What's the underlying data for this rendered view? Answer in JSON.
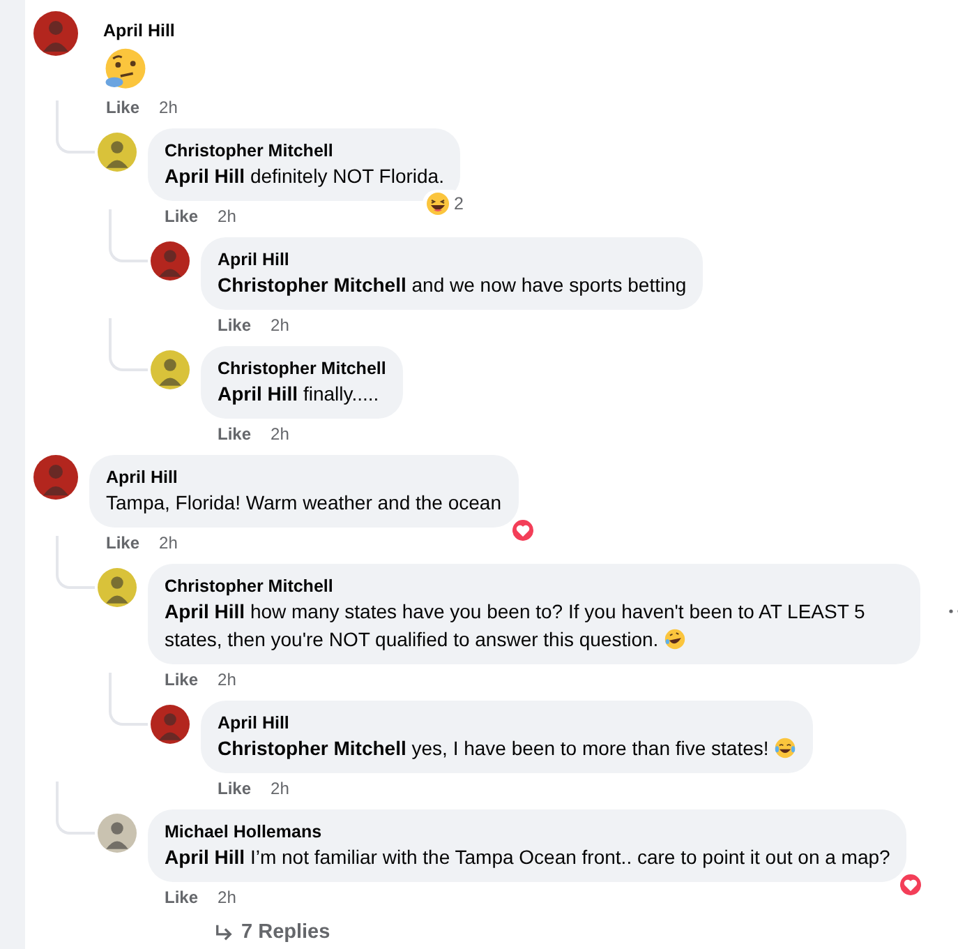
{
  "comments": [
    {
      "author": "April Hill",
      "color": "#b3261e",
      "kind": "emoji",
      "emoji": {
        "kind": "thinking"
      },
      "like": "Like",
      "time": "2h",
      "children": [
        {
          "author": "Christopher Mitchell",
          "color": "#d9c23a",
          "kind": "text",
          "text": "**April Hill** definitely NOT Florida.",
          "reaction": {
            "kind": "haha",
            "count": "2"
          },
          "like": "Like",
          "time": "2h",
          "children": [
            {
              "author": "April Hill",
              "color": "#b3261e",
              "kind": "text",
              "text": "**Christopher Mitchell** and we now have sports betting",
              "like": "Like",
              "time": "2h"
            },
            {
              "author": "Christopher Mitchell",
              "color": "#d9c23a",
              "kind": "text",
              "text": "**April Hill** finally.....",
              "like": "Like",
              "time": "2h"
            }
          ]
        }
      ]
    },
    {
      "author": "April Hill",
      "color": "#b3261e",
      "kind": "text",
      "text": "Tampa, Florida! Warm weather and the ocean",
      "reaction": {
        "kind": "love"
      },
      "like": "Like",
      "time": "2h",
      "children": [
        {
          "author": "Christopher Mitchell",
          "color": "#d9c23a",
          "kind": "text",
          "text": "**April Hill** how many states have you been to? If you haven't been to AT LEAST 5 states, then you're NOT qualified to answer this question.",
          "emoji": {
            "kind": "rofl"
          },
          "more_menu": true,
          "like": "Like",
          "time": "2h",
          "children": [
            {
              "author": "April Hill",
              "color": "#b3261e",
              "kind": "text",
              "text": "**Christopher Mitchell** yes, I have been to more than five states!",
              "emoji": {
                "kind": "tears_of_joy"
              },
              "like": "Like",
              "time": "2h"
            }
          ]
        },
        {
          "author": "Michael Hollemans",
          "color": "#c9c2b0",
          "kind": "text",
          "text": "**April Hill** I’m not familiar with the Tampa Ocean front.. care to point it out on a map?",
          "reaction": {
            "kind": "love"
          },
          "like": "Like",
          "time": "2h",
          "replies_link": "7 Replies"
        }
      ]
    }
  ]
}
